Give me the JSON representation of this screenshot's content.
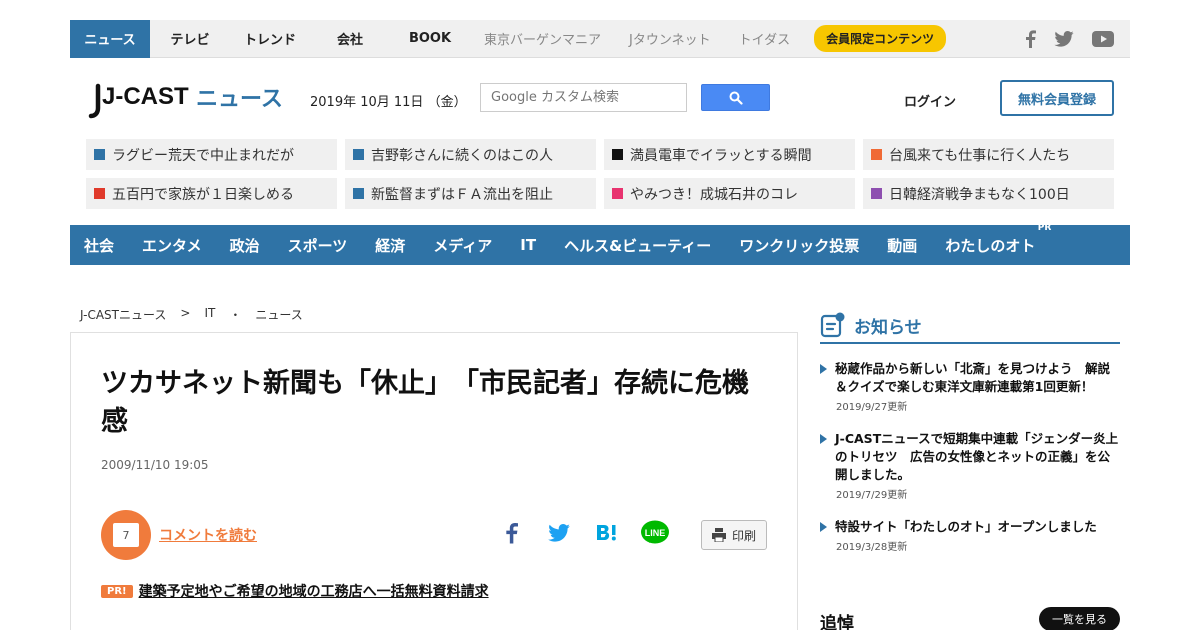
{
  "topnav": {
    "items": [
      "ニュース",
      "テレビ",
      "トレンド",
      "会社",
      "BOOK"
    ],
    "secondary": [
      "東京バーゲンマニア",
      "Jタウンネット",
      "トイダス"
    ],
    "member": "会員限定コンテンツ",
    "active_color": "#2f73a6"
  },
  "header": {
    "logo_a": "J-CAST",
    "logo_b": "ニュース",
    "date": "2019年 10月 11日 （金）",
    "search_placeholder": "Google カスタム検索",
    "login": "ログイン",
    "register": "無料会員登録"
  },
  "topics": [
    {
      "text": "ラグビー荒天で中止まれだが",
      "color": "#2f73a6"
    },
    {
      "text": "吉野彰さんに続くのはこの人",
      "color": "#2f73a6"
    },
    {
      "text": "満員電車でイラッとする瞬間",
      "color": "#111111"
    },
    {
      "text": "台風来ても仕事に行く人たち",
      "color": "#f06a35"
    },
    {
      "text": "五百円で家族が１日楽しめる",
      "color": "#e03a2b"
    },
    {
      "text": "新監督まずはＦＡ流出を阻止",
      "color": "#2f73a6"
    },
    {
      "text": "やみつき！成城石井のコレ",
      "color": "#e8336f"
    },
    {
      "text": "日韓経済戦争まもなく100日",
      "color": "#8e4fb0"
    }
  ],
  "categories": [
    "社会",
    "エンタメ",
    "政治",
    "スポーツ",
    "経済",
    "メディア",
    "IT",
    "ヘルス&ビューティー",
    "ワンクリック投票",
    "動画",
    "わたしのオト"
  ],
  "category_pr": "PR",
  "breadcrumb": [
    "J-CASTニュース",
    ">",
    "IT",
    "・",
    "ニュース"
  ],
  "article": {
    "headline": "ツカサネット新聞も「休止」　「市民記者」存続に危機感",
    "date": "2009/11/10 19:05",
    "comment_count": "7",
    "comment_link": "コメントを読む",
    "print": "印刷",
    "pr_tag": "PR!",
    "pr_link": "建築予定地やご希望の地域の工務店へ一括無料資料請求"
  },
  "sidebar": {
    "title": "お知らせ",
    "notices": [
      {
        "text": "秘蔵作品から新しい「北斎」を見つけよう　解説＆クイズで楽しむ東洋文庫新連載第1回更新！",
        "date": "2019/9/27更新"
      },
      {
        "text": "J-CASTニュースで短期集中連載「ジェンダー炎上のトリセツ　広告の女性像とネットの正義」を公開しました。",
        "date": "2019/7/29更新"
      },
      {
        "text": "特設サイト「わたしのオト」オープンしました",
        "date": "2019/3/28更新"
      }
    ],
    "tsuito": "追悼",
    "more": "一覧を見る"
  }
}
